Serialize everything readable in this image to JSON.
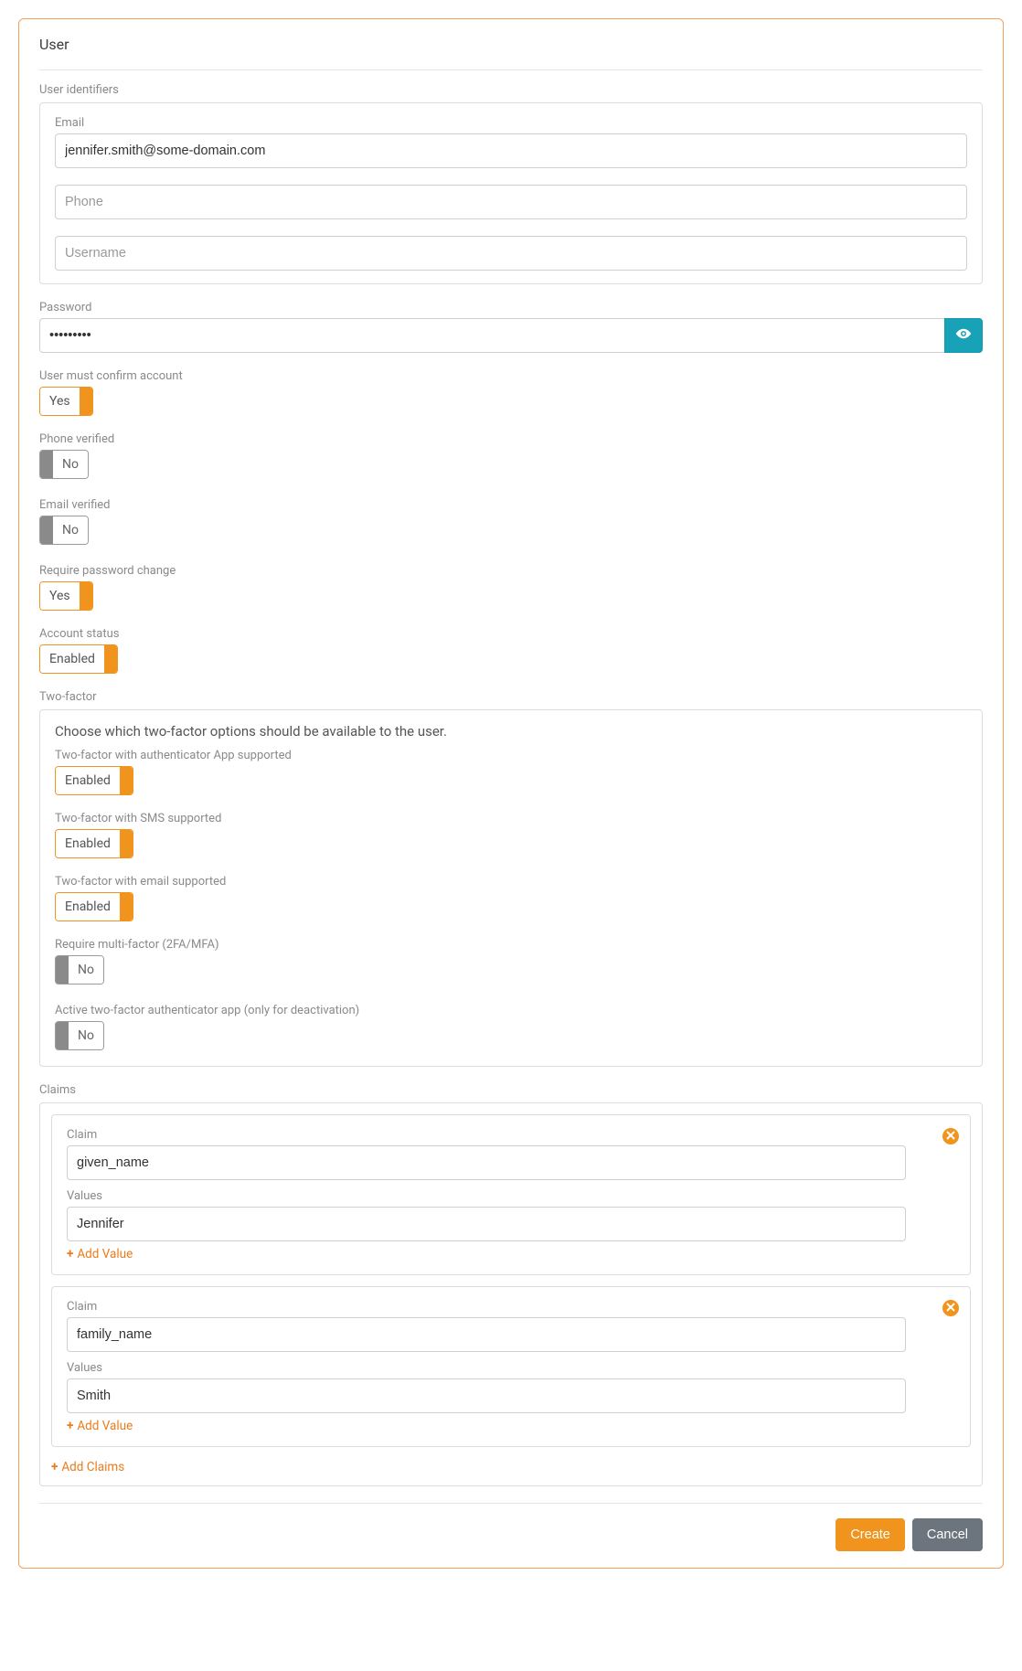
{
  "page_title": "User",
  "identifiers": {
    "legend": "User identifiers",
    "email_label": "Email",
    "email_value": "jennifer.smith@some-domain.com",
    "phone_placeholder": "Phone",
    "phone_value": "",
    "username_placeholder": "Username",
    "username_value": ""
  },
  "password": {
    "label": "Password",
    "value": "•••••••••"
  },
  "toggles": {
    "must_confirm": {
      "label": "User must confirm account",
      "value": "Yes",
      "on": true
    },
    "phone_verified": {
      "label": "Phone verified",
      "value": "No",
      "on": false
    },
    "email_verified": {
      "label": "Email verified",
      "value": "No",
      "on": false
    },
    "require_pw_change": {
      "label": "Require password change",
      "value": "Yes",
      "on": true
    },
    "account_status": {
      "label": "Account status",
      "value": "Enabled",
      "on": true
    }
  },
  "two_factor": {
    "legend": "Two-factor",
    "note": "Choose which two-factor options should be available to the user.",
    "app": {
      "label": "Two-factor with authenticator App supported",
      "value": "Enabled",
      "on": true
    },
    "sms": {
      "label": "Two-factor with SMS supported",
      "value": "Enabled",
      "on": true
    },
    "email": {
      "label": "Two-factor with email supported",
      "value": "Enabled",
      "on": true
    },
    "require_mfa": {
      "label": "Require multi-factor (2FA/MFA)",
      "value": "No",
      "on": false
    },
    "active_app": {
      "label": "Active two-factor authenticator app (only for deactivation)",
      "value": "No",
      "on": false
    }
  },
  "claims": {
    "legend": "Claims",
    "claim_label": "Claim",
    "values_label": "Values",
    "add_value_label": "Add Value",
    "add_claims_label": "Add Claims",
    "items": [
      {
        "claim": "given_name",
        "value": "Jennifer"
      },
      {
        "claim": "family_name",
        "value": "Smith"
      }
    ]
  },
  "footer": {
    "create": "Create",
    "cancel": "Cancel"
  }
}
